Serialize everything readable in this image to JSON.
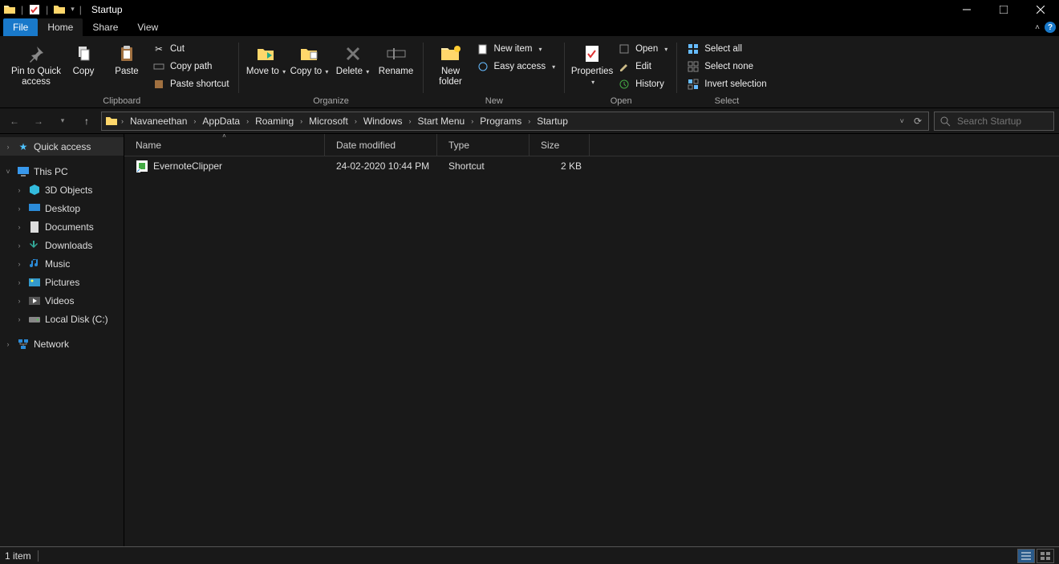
{
  "window": {
    "title": "Startup"
  },
  "tabs": {
    "file": "File",
    "home": "Home",
    "share": "Share",
    "view": "View"
  },
  "ribbon": {
    "clipboard": {
      "title": "Clipboard",
      "pin": "Pin to Quick access",
      "copy": "Copy",
      "paste": "Paste",
      "cut": "Cut",
      "copy_path": "Copy path",
      "paste_shortcut": "Paste shortcut"
    },
    "organize": {
      "title": "Organize",
      "move_to": "Move to",
      "copy_to": "Copy to",
      "delete": "Delete",
      "rename": "Rename"
    },
    "new": {
      "title": "New",
      "new_folder": "New folder",
      "new_item": "New item",
      "easy_access": "Easy access"
    },
    "open": {
      "title": "Open",
      "properties": "Properties",
      "open": "Open",
      "edit": "Edit",
      "history": "History"
    },
    "select": {
      "title": "Select",
      "all": "Select all",
      "none": "Select none",
      "invert": "Invert selection"
    }
  },
  "breadcrumb": [
    "Navaneethan",
    "AppData",
    "Roaming",
    "Microsoft",
    "Windows",
    "Start Menu",
    "Programs",
    "Startup"
  ],
  "search": {
    "placeholder": "Search Startup"
  },
  "nav": {
    "quick_access": "Quick access",
    "this_pc": "This PC",
    "items": [
      {
        "label": "3D Objects"
      },
      {
        "label": "Desktop"
      },
      {
        "label": "Documents"
      },
      {
        "label": "Downloads"
      },
      {
        "label": "Music"
      },
      {
        "label": "Pictures"
      },
      {
        "label": "Videos"
      },
      {
        "label": "Local Disk (C:)"
      }
    ],
    "network": "Network"
  },
  "columns": {
    "name": "Name",
    "date": "Date modified",
    "type": "Type",
    "size": "Size"
  },
  "files": [
    {
      "name": "EvernoteClipper",
      "date": "24-02-2020 10:44 PM",
      "type": "Shortcut",
      "size": "2 KB"
    }
  ],
  "status": {
    "count": "1 item"
  }
}
